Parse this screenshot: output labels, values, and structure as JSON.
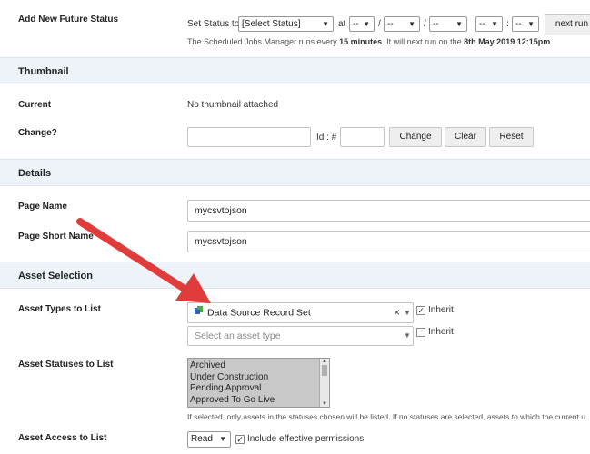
{
  "future_status": {
    "label": "Add New Future Status",
    "set_status_to": "Set Status to",
    "status_select": "[Select Status]",
    "at": "at",
    "day": "--",
    "month": "--",
    "year": "--",
    "hour": "--",
    "minute": "--",
    "slash1": "/",
    "slash2": "/",
    "colon": ":",
    "next_run_button": "next run",
    "info_prefix": "The Scheduled Jobs Manager runs every ",
    "info_interval": "15 minutes",
    "info_middle": ". It will next run on the ",
    "info_date": "8th May 2019 12:15pm",
    "info_end": "."
  },
  "thumbnail": {
    "section_title": "Thumbnail",
    "current_label": "Current",
    "current_value": "No thumbnail attached",
    "change_label": "Change?",
    "id_label": "Id : #",
    "change_button": "Change",
    "clear_button": "Clear",
    "reset_button": "Reset"
  },
  "details": {
    "section_title": "Details",
    "page_name_label": "Page Name",
    "page_name_value": "mycsvtojson",
    "page_short_name_label": "Page Short Name",
    "page_short_name_value": "mycsvtojson"
  },
  "asset_selection": {
    "section_title": "Asset Selection",
    "types_label": "Asset Types to List",
    "selected_type": "Data Source Record Set",
    "clear_x": "×",
    "inherit_label_1": "Inherit",
    "inherit_1_checked": true,
    "type_placeholder": "Select an asset type",
    "inherit_label_2": "Inherit",
    "inherit_2_checked": false,
    "statuses_label": "Asset Statuses to List",
    "statuses": [
      "Archived",
      "Under Construction",
      "Pending Approval",
      "Approved To Go Live"
    ],
    "statuses_help": "If selected, only assets in the statuses chosen will be listed. If no statuses are selected, assets to which the current u",
    "access_label": "Asset Access to List",
    "access_value": "Read",
    "effective_permissions_label": "Include effective permissions",
    "effective_permissions_checked": true
  },
  "colors": {
    "section_bg": "#eef3f9",
    "arrow": "#e03c3c",
    "listbox_bg": "#c8c8c8"
  }
}
